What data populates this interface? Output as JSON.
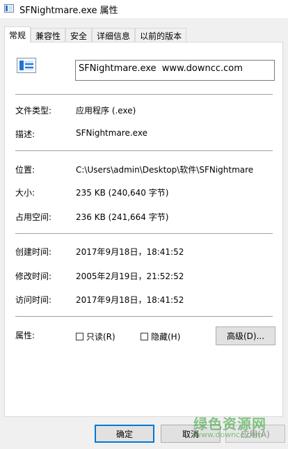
{
  "window": {
    "title": "SFNightmare.exe 属性"
  },
  "tabs": [
    {
      "label": "常规",
      "active": true
    },
    {
      "label": "兼容性"
    },
    {
      "label": "安全"
    },
    {
      "label": "详细信息"
    },
    {
      "label": "以前的版本"
    }
  ],
  "general": {
    "icon": "application-window-icon",
    "filename": "SFNightmare.exe  www.downcc.com",
    "file_type": {
      "label": "文件类型:",
      "value": "应用程序 (.exe)"
    },
    "description": {
      "label": "描述:",
      "value": "SFNightmare.exe"
    },
    "location": {
      "label": "位置:",
      "value": "C:\\Users\\admin\\Desktop\\软件\\SFNightmare"
    },
    "size": {
      "label": "大小:",
      "value": "235 KB (240,640 字节)"
    },
    "size_on_disk": {
      "label": "占用空间:",
      "value": "236 KB (241,664 字节)"
    },
    "created": {
      "label": "创建时间:",
      "value": "2017年9月18日，18:41:52"
    },
    "modified": {
      "label": "修改时间:",
      "value": "2005年2月19日，21:52:52"
    },
    "accessed": {
      "label": "访问时间:",
      "value": "2017年9月18日，18:41:52"
    },
    "attributes": {
      "label": "属性:",
      "readonly": {
        "label": "只读(R)",
        "checked": false
      },
      "hidden": {
        "label": "隐藏(H)",
        "checked": false
      },
      "advanced_label": "高级(D)..."
    }
  },
  "buttons": {
    "ok": "确定",
    "cancel": "取消",
    "apply": "应用(A)"
  },
  "watermark": {
    "text": "绿色资源网",
    "url": "www.downcc.com",
    "color": "#2ca02c"
  }
}
